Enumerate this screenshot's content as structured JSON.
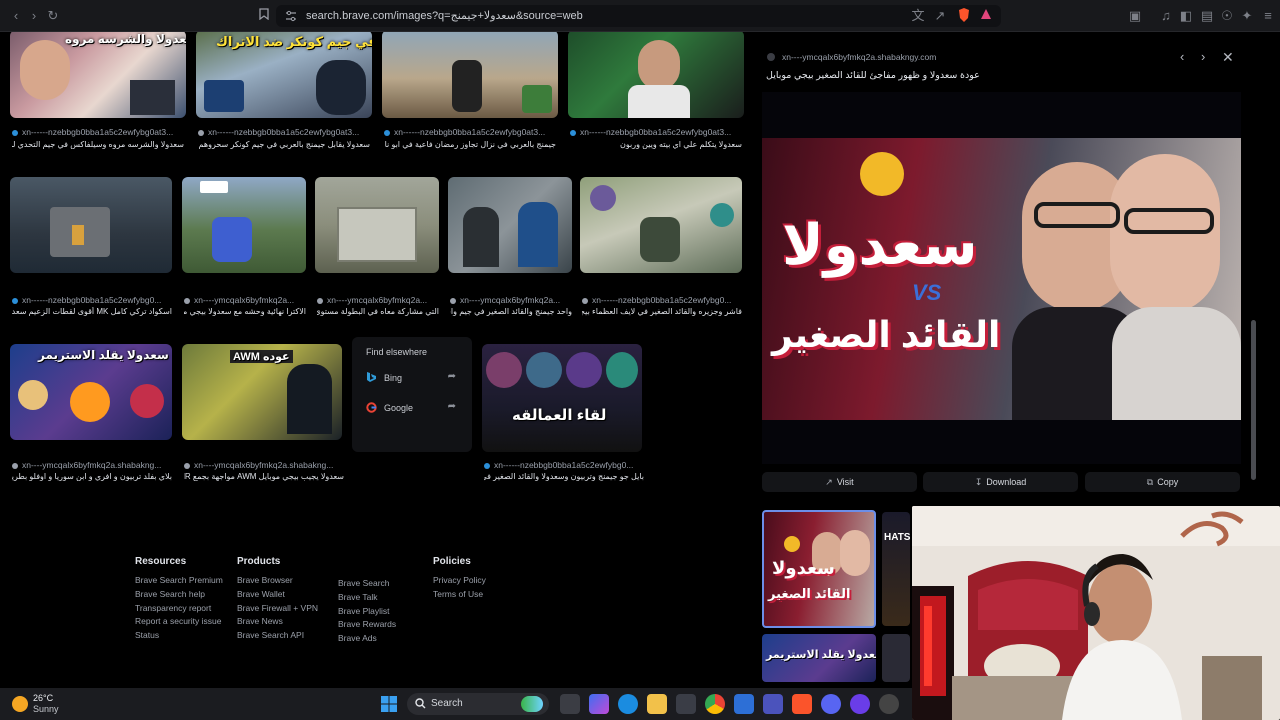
{
  "browser": {
    "url": "search.brave.com/images?q=سعدولا+جيمنج&source=web",
    "icons": [
      "back-icon",
      "forward-icon",
      "reload-icon",
      "bookmark-icon",
      "tune-icon",
      "translate-icon",
      "share-icon",
      "brave-shield-icon",
      "rewards-icon",
      "tabs-icon",
      "media-icon",
      "sidebar-icon",
      "wallet-icon",
      "vpn-icon",
      "leo-icon",
      "menu-icon"
    ]
  },
  "results": {
    "row1": [
      {
        "source": "xn------nzebbgb0bba1a5c2ewfybg0at3...",
        "title": "سعدولا والشرسه مروه وسيلفاكس في جيم التحدي لسعدولا",
        "label": "سعدولا والشرسه مروه"
      },
      {
        "source": "xn------nzebbgb0bba1a5c2ewfybg0at3...",
        "title": "سعدولا يقابل جيمنج بالعربي في جيم كونكر سحروهم ضد الاتراك",
        "label": "في جيم كونكر ضد الاتراك"
      },
      {
        "source": "xn------nzebbgb0bba1a5c2ewfybg0at3...",
        "title": "جيمنج بالعربي في نزال تجاوز رمضان فاعية في ابو ناجي ريمو ساري",
        "label": ""
      },
      {
        "source": "xn------nzebbgb0bba1a5c2ewfybg0at3...",
        "title": "سعدولا يتكلم علي اي بيته ويين وربون",
        "label": ""
      }
    ],
    "row2": [
      {
        "source": "xn------nzebbgb0bba1a5c2ewfybg0...",
        "title": "اسكواد تركي كامل MK أقوى لقطات الزعيم سعدولا في"
      },
      {
        "source": "xn----ymcqalx6byfmkq2a...",
        "title": "الاكترا نهائية وحشه مع سعدولا بيجي موبايل"
      },
      {
        "source": "xn----ymcqalx6byfmkq2a...",
        "title": "التي مشاركة معاه في البطولة مستوى عالي"
      },
      {
        "source": "xn----ymcqalx6byfmkq2a...",
        "title": "واحد جيمنج والقائد الصغير في جيم واحد"
      },
      {
        "source": "xn------nzebbgb0bba1a5c2ewfybg0...",
        "title": "فاشر وجزيره والقائد الصغير في لايف العظماء بيجي موبايل"
      }
    ],
    "row3": [
      {
        "source": "xn----ymcqalx6byfmkq2a.shabakng...",
        "title": "بلاي بفلد تربيون و افري و ابن سوريا و اوفلو بطريقه مضحكة",
        "label": "سعدولا يقلد الاستريمر"
      },
      {
        "source": "xn----ymcqalx6byfmkq2a.shabakng...",
        "title": "سعدولا يجيب بيجي موبايل AWM مواجهة بجمع DMR صيد بـ",
        "label": "AWM عوده"
      },
      {
        "source": "xn------nzebbgb0bba1a5c2ewfybg0...",
        "title": "بايل جو جيمنج وتربيون وسعدولا والقائد الصغير في لايف",
        "label": "لقاء العمالقه"
      }
    ],
    "find_elsewhere": {
      "title": "Find elsewhere",
      "options": [
        "Bing",
        "Google"
      ]
    }
  },
  "footer": {
    "columns": [
      {
        "heading": "Resources",
        "links": [
          "Brave Search Premium",
          "Brave Search help",
          "Transparency report",
          "Report a security issue",
          "Status"
        ]
      },
      {
        "heading": "Products",
        "links": [
          "Brave Browser",
          "Brave Wallet",
          "Brave Firewall + VPN",
          "Brave News",
          "Brave Search API"
        ]
      },
      {
        "heading": "",
        "links": [
          "Brave Search",
          "Brave Talk",
          "Brave Playlist",
          "Brave Rewards",
          "Brave Ads"
        ]
      },
      {
        "heading": "Policies",
        "links": [
          "Privacy Policy",
          "Terms of Use"
        ]
      }
    ]
  },
  "preview": {
    "source": "xn----ymcqalx6byfmkq2a.shabakngy.com",
    "title": "عودة سعدولا و ظهور مفاجئ للقائد الصغير بيجي موبايل",
    "image_text_main": "سعدولا",
    "image_text_vs": "VS",
    "image_text_sub": "القائد الصغير",
    "actions": {
      "visit": "Visit",
      "download": "Download",
      "copy": "Copy"
    }
  },
  "related": {
    "thumb1_text": "سعدولا",
    "thumb1_sub": "القائد الصغير",
    "thumb2_text": "سعدولا يقلد الاستريمر"
  },
  "taskbar": {
    "temperature": "26°C",
    "condition": "Sunny",
    "search_label": "Search"
  },
  "colors": {
    "accent": "#2b8fd9",
    "brave": "#fb542b",
    "background": "#000000"
  }
}
